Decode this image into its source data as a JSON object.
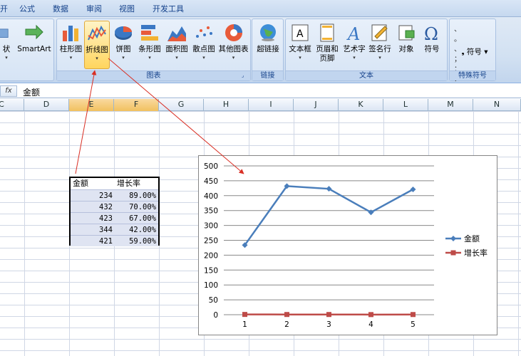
{
  "tabs": [
    "公式",
    "数据",
    "审阅",
    "视图",
    "开发工具"
  ],
  "tab_partial": "开",
  "ribbon": {
    "left_partial_label": "状",
    "smartart_label": "SmartArt",
    "chart_group": {
      "label": "图表",
      "buttons": [
        "柱形图",
        "折线图",
        "饼图",
        "条形图",
        "面积图",
        "散点图",
        "其他图表"
      ]
    },
    "link_group": {
      "label": "链接",
      "button": "超链接"
    },
    "text_group": {
      "label": "文本",
      "buttons": [
        "文本框",
        "页眉和\n页脚",
        "艺术字",
        "签名行",
        "对象",
        "符号"
      ]
    },
    "special_group": {
      "label": "特殊符号",
      "button": "符号"
    }
  },
  "formula": {
    "fx": "fx",
    "value": "金额"
  },
  "columns": [
    "C",
    "D",
    "E",
    "F",
    "G",
    "H",
    "I",
    "J",
    "K",
    "L",
    "M",
    "N"
  ],
  "table": {
    "headers": [
      "金额",
      "增长率"
    ],
    "rows": [
      [
        "234",
        "89.00%"
      ],
      [
        "432",
        "70.00%"
      ],
      [
        "423",
        "67.00%"
      ],
      [
        "344",
        "42.00%"
      ],
      [
        "421",
        "59.00%"
      ]
    ]
  },
  "chart_data": {
    "type": "line",
    "x": [
      1,
      2,
      3,
      4,
      5
    ],
    "categories": [
      "1",
      "2",
      "3",
      "4",
      "5"
    ],
    "series": [
      {
        "name": "金额",
        "values": [
          234,
          432,
          423,
          344,
          421
        ],
        "color": "#4a7ebb",
        "marker": "diamond"
      },
      {
        "name": "增长率",
        "values": [
          0.89,
          0.7,
          0.67,
          0.42,
          0.59
        ],
        "color": "#be4b48",
        "marker": "square"
      }
    ],
    "ylim": [
      0,
      500
    ],
    "yticks": [
      0,
      50,
      100,
      150,
      200,
      250,
      300,
      350,
      400,
      450,
      500
    ],
    "grid": true,
    "legend": "right"
  },
  "colors": {
    "accent": "#f1c15f",
    "arrow": "#d93025",
    "ribbon": "#d2e1f2"
  }
}
